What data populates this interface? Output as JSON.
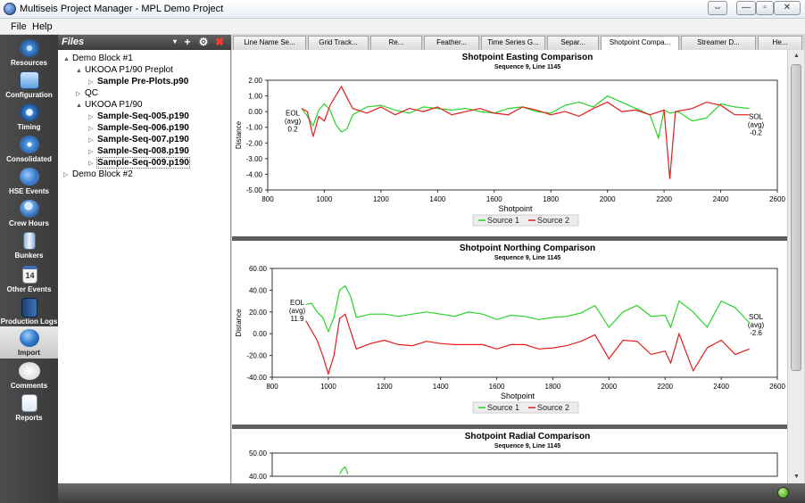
{
  "window": {
    "title": "Multiseis Project Manager - MPL Demo Project",
    "buttons": [
      "⇔",
      "—",
      "▫",
      "✕"
    ]
  },
  "menu": [
    "File",
    "Help"
  ],
  "nav": [
    {
      "label": "Resources",
      "icon": "resources-icon",
      "color": "#4a8fd8"
    },
    {
      "label": "Configuration",
      "icon": "configuration-icon",
      "color": "#5b9fe0"
    },
    {
      "label": "Timing",
      "icon": "timing-icon",
      "color": "#3f87d6"
    },
    {
      "label": "Consolidated",
      "icon": "consolidated-icon",
      "color": "#5aa0e8"
    },
    {
      "label": "HSE Events",
      "icon": "hse-events-icon",
      "color": "#3a78c8"
    },
    {
      "label": "Crew Hours",
      "icon": "crew-hours-icon",
      "color": "#6aa8e8"
    },
    {
      "label": "Bunkers",
      "icon": "bunkers-icon",
      "color": "#8fb3d8"
    },
    {
      "label": "Other Events",
      "icon": "calendar-icon",
      "color": "#e9e9e9"
    },
    {
      "label": "Production Logs",
      "icon": "production-logs-icon",
      "color": "#2f5e9a"
    },
    {
      "label": "Import",
      "icon": "import-icon",
      "color": "#2f77c8"
    },
    {
      "label": "Comments",
      "icon": "comments-icon",
      "color": "#f2f2f2"
    },
    {
      "label": "Reports",
      "icon": "reports-icon",
      "color": "#dfe8f4"
    }
  ],
  "files": {
    "title": "Files",
    "tree": [
      {
        "label": "Demo Block #1",
        "level": 0,
        "arrow": "▲",
        "bold": false
      },
      {
        "label": "UKOOA P1/90 Preplot",
        "level": 1,
        "arrow": "▲",
        "bold": false
      },
      {
        "label": "Sample Pre-Plots.p90",
        "level": 2,
        "arrow": "▷",
        "bold": true
      },
      {
        "label": "QC",
        "level": 1,
        "arrow": "▷",
        "bold": false
      },
      {
        "label": "UKOOA P1/90",
        "level": 1,
        "arrow": "▲",
        "bold": false
      },
      {
        "label": "Sample-Seq-005.p190",
        "level": 2,
        "arrow": "▷",
        "bold": true
      },
      {
        "label": "Sample-Seq-006.p190",
        "level": 2,
        "arrow": "▷",
        "bold": true
      },
      {
        "label": "Sample-Seq-007.p190",
        "level": 2,
        "arrow": "▷",
        "bold": true
      },
      {
        "label": "Sample-Seq-008.p190",
        "level": 2,
        "arrow": "▷",
        "bold": true
      },
      {
        "label": "Sample-Seq-009.p190",
        "level": 2,
        "arrow": "▷",
        "bold": true
      },
      {
        "label": "Demo Block #2",
        "level": 0,
        "arrow": "▷",
        "bold": false
      }
    ]
  },
  "tabs": [
    {
      "label": "Line Name Se...",
      "active": false
    },
    {
      "label": "Grid Track...",
      "active": false
    },
    {
      "label": "Re...",
      "active": false
    },
    {
      "label": "Feather...",
      "active": false
    },
    {
      "label": "Time Series G...",
      "active": false
    },
    {
      "label": "Separ...",
      "active": false
    },
    {
      "label": "Shotpoint Compa...",
      "active": true
    },
    {
      "label": "Streamer D...",
      "active": false
    },
    {
      "label": "He...",
      "active": false
    }
  ],
  "chart_data": [
    {
      "type": "line",
      "title": "Shotpoint Easting Comparison",
      "subtitle": "Sequence 9, Line 1145",
      "xlabel": "Shotpoint",
      "ylabel": "Distance",
      "xlim": [
        800,
        2600
      ],
      "ylim": [
        -5,
        2
      ],
      "xticks": [
        800,
        1000,
        1200,
        1400,
        1600,
        1800,
        2000,
        2200,
        2400,
        2600
      ],
      "yticks": [
        "2.00",
        "1.00",
        "0.00",
        "-1.00",
        "-2.00",
        "-3.00",
        "-4.00",
        "-5.00"
      ],
      "yticks_values": [
        2,
        1,
        0,
        -1,
        -2,
        -3,
        -4,
        -5
      ],
      "left_annotation": [
        "EOL",
        "(avg)",
        "0.2"
      ],
      "right_annotation": [
        "SOL",
        "(avg)",
        "-0.2"
      ],
      "series": [
        {
          "name": "Source 1",
          "color": "#27d427",
          "x": [
            920,
            940,
            960,
            980,
            1000,
            1020,
            1040,
            1060,
            1080,
            1100,
            1150,
            1200,
            1250,
            1300,
            1350,
            1400,
            1450,
            1500,
            1550,
            1600,
            1650,
            1700,
            1750,
            1800,
            1850,
            1900,
            1950,
            2000,
            2050,
            2100,
            2150,
            2180,
            2200,
            2220,
            2250,
            2300,
            2350,
            2400,
            2450,
            2500
          ],
          "y": [
            0.2,
            -0.3,
            -0.9,
            0.1,
            0.5,
            0.1,
            -0.8,
            -1.3,
            -1.1,
            -0.2,
            0.3,
            0.4,
            0.1,
            -0.1,
            0.3,
            0.2,
            0.1,
            0.2,
            0.0,
            -0.1,
            0.2,
            0.3,
            0.0,
            -0.1,
            0.4,
            0.6,
            0.3,
            1.0,
            0.6,
            0.2,
            -0.2,
            -1.7,
            0.1,
            -0.1,
            0.0,
            -0.6,
            -0.4,
            0.5,
            0.3,
            0.2
          ]
        },
        {
          "name": "Source 2",
          "color": "#e41c1c",
          "x": [
            920,
            940,
            960,
            980,
            1000,
            1020,
            1040,
            1060,
            1080,
            1100,
            1150,
            1200,
            1250,
            1300,
            1350,
            1400,
            1450,
            1500,
            1550,
            1600,
            1650,
            1700,
            1750,
            1800,
            1850,
            1900,
            1950,
            2000,
            2050,
            2100,
            2150,
            2200,
            2220,
            2240,
            2300,
            2350,
            2400,
            2450,
            2500
          ],
          "y": [
            0.2,
            0.0,
            -1.6,
            -0.3,
            -0.6,
            0.4,
            1.0,
            1.6,
            0.9,
            0.2,
            -0.1,
            0.3,
            -0.2,
            0.2,
            0.0,
            0.3,
            -0.2,
            0.0,
            0.2,
            -0.1,
            -0.2,
            0.3,
            0.1,
            -0.2,
            0.0,
            -0.3,
            0.2,
            0.6,
            0.0,
            0.1,
            -0.2,
            0.1,
            -4.3,
            0.0,
            0.2,
            0.6,
            0.4,
            -0.2,
            -0.2
          ]
        }
      ],
      "legend_position": "bottom-center"
    },
    {
      "type": "line",
      "title": "Shotpoint Northing Comparison",
      "subtitle": "Sequence 9, Line 1145",
      "xlabel": "Shotpoint",
      "ylabel": "Distance",
      "xlim": [
        800,
        2600
      ],
      "ylim": [
        -40,
        60
      ],
      "xticks": [
        800,
        1000,
        1200,
        1400,
        1600,
        1800,
        2000,
        2200,
        2400,
        2600
      ],
      "yticks": [
        "60.00",
        "40.00",
        "20.00",
        "0.00",
        "-20.00",
        "-40.00"
      ],
      "yticks_values": [
        60,
        40,
        20,
        0,
        -20,
        -40
      ],
      "left_annotation": [
        "EOL",
        "(avg)",
        "11.9"
      ],
      "right_annotation": [
        "SOL",
        "(avg)",
        "-2.6"
      ],
      "series": [
        {
          "name": "Source 1",
          "color": "#27d427",
          "x": [
            920,
            940,
            960,
            980,
            1000,
            1020,
            1040,
            1060,
            1080,
            1100,
            1150,
            1200,
            1250,
            1300,
            1350,
            1400,
            1450,
            1500,
            1550,
            1600,
            1650,
            1700,
            1750,
            1800,
            1850,
            1900,
            1950,
            1980,
            2000,
            2050,
            2100,
            2150,
            2200,
            2220,
            2250,
            2300,
            2350,
            2400,
            2450,
            2500
          ],
          "y": [
            27,
            28,
            20,
            15,
            2,
            15,
            40,
            44,
            34,
            15,
            18,
            18,
            16,
            18,
            20,
            18,
            16,
            20,
            18,
            13,
            17,
            16,
            13,
            15,
            16,
            19,
            26,
            14,
            6,
            20,
            26,
            16,
            17,
            6,
            30,
            20,
            6,
            30,
            24,
            10
          ]
        },
        {
          "name": "Source 2",
          "color": "#e41c1c",
          "x": [
            920,
            940,
            960,
            980,
            1000,
            1020,
            1040,
            1060,
            1080,
            1100,
            1150,
            1200,
            1250,
            1300,
            1350,
            1400,
            1450,
            1500,
            1550,
            1600,
            1650,
            1700,
            1750,
            1800,
            1850,
            1900,
            1950,
            1980,
            2000,
            2050,
            2100,
            2150,
            2200,
            2220,
            2250,
            2300,
            2350,
            2400,
            2450,
            2500
          ],
          "y": [
            12,
            3,
            -6,
            -20,
            -37,
            -20,
            14,
            18,
            2,
            -14,
            -9,
            -6,
            -10,
            -11,
            -7,
            -9,
            -10,
            -10,
            -10,
            -14,
            -10,
            -10,
            -14,
            -13,
            -11,
            -7,
            -1,
            -14,
            -23,
            -6,
            -7,
            -19,
            -16,
            -27,
            0,
            -34,
            -13,
            -6,
            -19,
            -14
          ]
        }
      ],
      "legend_position": "bottom-center"
    },
    {
      "type": "line",
      "title": "Shotpoint Radial Comparison",
      "subtitle": "Sequence 9, Line 1145",
      "xlabel": "",
      "ylabel": "",
      "xlim": [
        800,
        2600
      ],
      "ylim": [
        40,
        50
      ],
      "xticks": [],
      "yticks": [
        "50.00",
        "40.00"
      ],
      "yticks_values": [
        50,
        40
      ],
      "left_annotation": [],
      "right_annotation": [],
      "series": [
        {
          "name": "",
          "color": "#27d427",
          "x": [
            1040,
            1050,
            1060,
            1070
          ],
          "y": [
            41,
            43,
            44,
            41
          ]
        }
      ],
      "legend_position": "bottom-center"
    }
  ]
}
